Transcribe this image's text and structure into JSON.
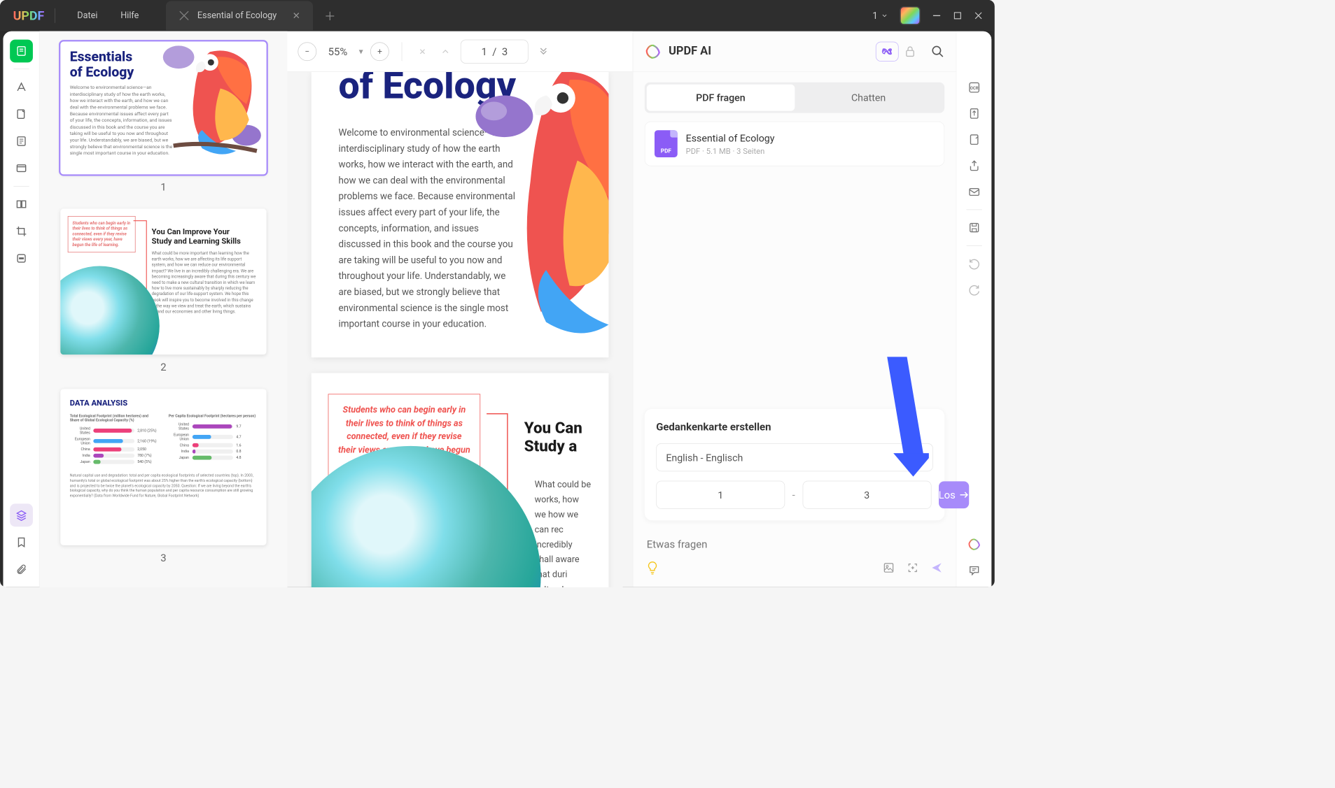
{
  "titlebar": {
    "logo": "UPDF",
    "menu_file": "Datei",
    "menu_help": "Hilfe",
    "tab_title": "Essential of Ecology",
    "tab_counter": "1"
  },
  "doc_toolbar": {
    "zoom": "55%",
    "page_indicator": "1  /  3"
  },
  "thumbnails": {
    "p1_title_l1": "Essentials",
    "p1_title_l2": "of Ecology",
    "p1_text": "Welcome to environmental science—an interdisciplinary study of how the earth works, how we interact with the earth, and how we can deal with the environmental problems we face. Because environmental issues affect every part of your life, the concepts, information, and issues discussed in this book and the course you are taking will be useful to you now and throughout your life. Understandably, we are biased, but we strongly believe that environmental science is the single most important course in your education.",
    "p1_num": "1",
    "p2_callout": "Students who can begin early in their lives to think of things as connected, even if they revise their views every year, have begun the life of learning.",
    "p2_heading": "You Can Improve Your Study and Learning Skills",
    "p2_text": "What could be more important than learning how the earth works, how we are affecting its life support system, and how we can reduce our environmental impact? We live in an incredibly challenging era. We are becoming increasingly aware that during this century we need to make a new cultural transition in which we learn how to live more sustainably by sharply reducing the degradation of our life-support system. We hope this book will inspire you to become involved in this change in the way we view and treat the earth, which sustains us and our economies and other living things.",
    "p2_num": "2",
    "p3_title": "DATA ANALYSIS",
    "p3_text": "Natural capital use and degradation: total and per capita ecological footprints of selected countries (top). In 2003, humanity's total or global ecological footprint was about 25% higher than the earth's ecological capacity (bottom) and is projected to be twice the planet's ecological capacity by 2050. Question: If we are living beyond the earth's biological capacity, why do you think the human population and per capita resource consumption are still growing exponentially? (Data from Worldwide Fund for Nature, Global Footprint Network)",
    "p3_num": "3"
  },
  "chart_data": [
    {
      "type": "bar",
      "title": "Total Ecological Footprint (million hectares) and Share of Global Ecological Capacity (%)",
      "categories": [
        "United States",
        "European Union",
        "China",
        "India",
        "Japan"
      ],
      "values": [
        2810,
        2160,
        2050,
        780,
        540
      ],
      "share_pct": [
        25,
        19,
        null,
        7,
        5
      ],
      "colors": [
        "#ec407a",
        "#42a5f5",
        "#ec407a",
        "#ab47bc",
        "#66bb6a"
      ]
    },
    {
      "type": "bar",
      "title": "Per Capita Ecological Footprint (hectares per person)",
      "categories": [
        "United States",
        "European Union",
        "China",
        "India",
        "Japan"
      ],
      "values": [
        9.7,
        4.7,
        1.6,
        0.8,
        4.8
      ],
      "colors": [
        "#ab47bc",
        "#42a5f5",
        "#ec407a",
        "#ab47bc",
        "#66bb6a"
      ]
    }
  ],
  "page1": {
    "title": "of Ecology",
    "body": "Welcome to environmental science—an interdisciplinary study of how the earth works, how we interact with the earth, and how we can deal with the environmental problems we face. Because environmental issues affect every part of your life, the concepts, information, and issues discussed in this book and the course you are taking will be useful to you now and throughout your life. Understandably, we are biased, but we strongly believe that environmental science is the single most important course in your education."
  },
  "page2": {
    "callout": "Students who can begin early in their lives to think of things as connected, even if they revise their views every year, have begun the life of learning.",
    "heading": "You Can Study a",
    "body": "What could be works, how we how we can rec incredibly chall aware that duri cultural transiti"
  },
  "ai": {
    "title": "UPDF AI",
    "tab_ask": "PDF fragen",
    "tab_chat": "Chatten",
    "file_name": "Essential of Ecology",
    "file_meta": "PDF · 5.1 MB · 3 Seiten",
    "mindmap_title": "Gedankenkarte erstellen",
    "lang_selected": "English - Englisch",
    "range_from": "1",
    "range_to": "3",
    "go_label": "Los",
    "prompt_placeholder": "Etwas fragen"
  }
}
